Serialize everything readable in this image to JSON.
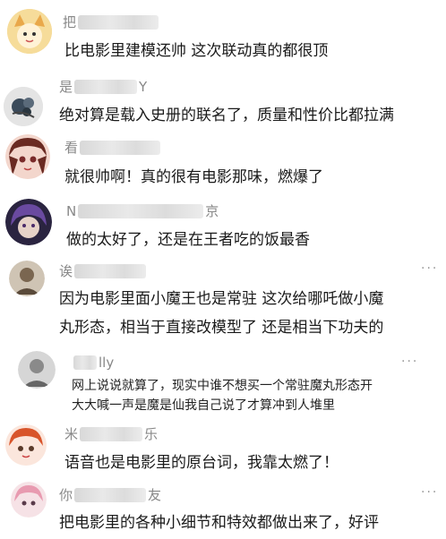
{
  "comments": [
    {
      "name_prefix": "把",
      "name_suffix": "",
      "text": [
        "比电影里建模还帅 这次联动真的都很顶"
      ],
      "avatar": "cartoon-face-avatar"
    },
    {
      "name_prefix": "是",
      "name_suffix": "Y",
      "text": [
        "绝对算是载入史册的联名了，质量和性价比都拉满"
      ],
      "avatar": "dark-floral-avatar"
    },
    {
      "name_prefix": "看",
      "name_suffix": "",
      "text": [
        "就很帅啊！真的很有电影那味，燃爆了"
      ],
      "avatar": "anime-girl-avatar"
    },
    {
      "name_prefix": "N",
      "name_suffix": "京",
      "text": [
        "做的太好了，还是在王者吃的饭最香"
      ],
      "avatar": "purple-hair-avatar"
    },
    {
      "name_prefix": "诶",
      "name_suffix": "",
      "text": [
        "因为电影里面小魔王也是常驻 这次给哪吒做小魔",
        "丸形态，相当于直接改模型了 还是相当下功夫的"
      ],
      "avatar": "person-photo-avatar",
      "more": "···"
    },
    {
      "name_prefix": "",
      "name_suffix": "lly",
      "text": [
        "网上说说就算了，现实中谁不想买一个常驻魔丸形态开",
        "大大喊一声是魔是仙我自己说了才算冲到人堆里"
      ],
      "avatar": "grey-photo-avatar",
      "more": "···"
    },
    {
      "name_prefix": "米",
      "name_suffix": "乐",
      "text": [
        "语音也是电影里的原台词，我靠太燃了！"
      ],
      "avatar": "redhead-anime-avatar"
    },
    {
      "name_prefix": "你",
      "name_suffix": "友",
      "text": [
        "把电影里的各种小细节和特效都做出来了，好评"
      ],
      "avatar": "pink-anime-avatar",
      "more": "···"
    }
  ],
  "colors": {
    "name": "#888888",
    "text": "#1a1a1a",
    "background": "#ffffff"
  }
}
